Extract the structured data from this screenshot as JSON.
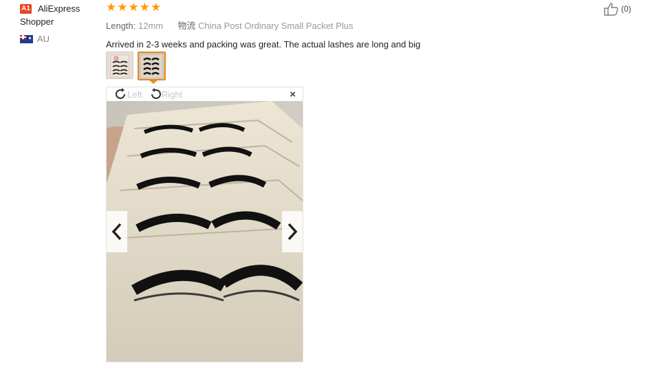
{
  "user": {
    "badge": "A1",
    "name_line1": "AliExpress",
    "name_line2": "Shopper",
    "country": "AU",
    "flag_icon": "australia-flag-icon"
  },
  "review": {
    "rating": 5,
    "stars": "★★★★★",
    "length_label": "Length:",
    "length_value": "12mm",
    "logistics_label": "物流",
    "logistics_value": "China Post Ordinary Small Packet Plus",
    "text": "Arrived in 2-3 weeks and packing was great. The actual lashes are long and big"
  },
  "thumbnails": [
    {
      "name": "thumb-1",
      "active": false
    },
    {
      "name": "thumb-2",
      "active": true
    }
  ],
  "viewer": {
    "rotate_left": "Left",
    "rotate_right": "Right",
    "close": "×"
  },
  "helpful": {
    "count": "(0)"
  },
  "colors": {
    "accent": "#e8891c",
    "star": "#ff9900",
    "badge": "#e8421c"
  }
}
